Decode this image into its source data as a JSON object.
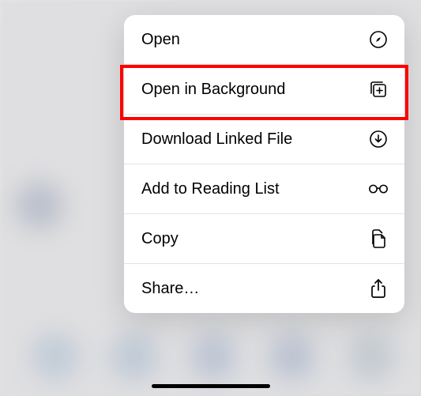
{
  "menu": {
    "items": [
      {
        "label": "Open",
        "icon": "compass-icon"
      },
      {
        "label": "Open in Background",
        "icon": "stack-plus-icon"
      },
      {
        "label": "Download Linked File",
        "icon": "download-circle-icon"
      },
      {
        "label": "Add to Reading List",
        "icon": "glasses-icon"
      },
      {
        "label": "Copy",
        "icon": "documents-icon"
      },
      {
        "label": "Share…",
        "icon": "share-icon"
      }
    ]
  },
  "highlighted_index": 1
}
